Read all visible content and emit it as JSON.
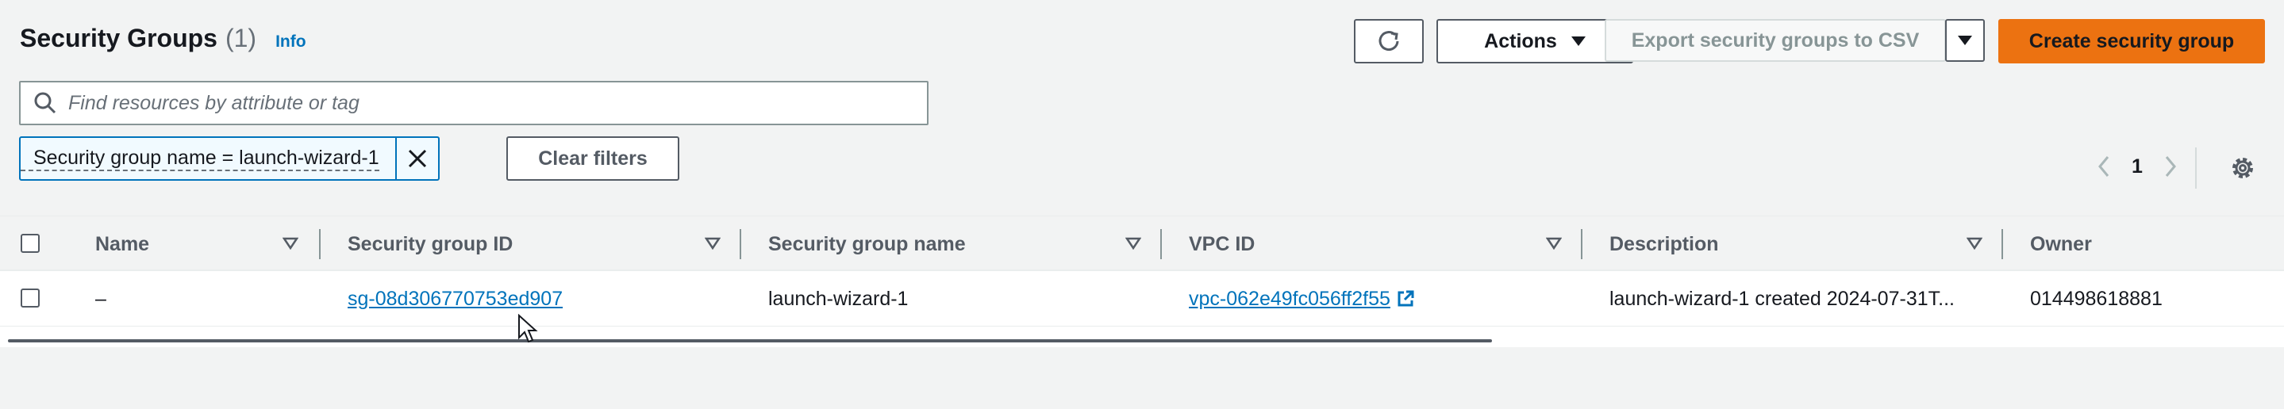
{
  "header": {
    "title": "Security Groups",
    "count": "(1)",
    "info": "Info"
  },
  "toolbar": {
    "refresh_icon": "refresh-icon",
    "actions_label": "Actions",
    "export_label": "Export security groups to CSV",
    "create_label": "Create security group"
  },
  "search": {
    "placeholder": "Find resources by attribute or tag",
    "value": ""
  },
  "filter": {
    "token_label": "Security group name = launch-wizard-1",
    "clear_label": "Clear filters"
  },
  "pagination": {
    "current_page": "1"
  },
  "table": {
    "columns": [
      "Name",
      "Security group ID",
      "Security group name",
      "VPC ID",
      "Description",
      "Owner"
    ],
    "rows": [
      {
        "name": "–",
        "security_group_id": "sg-08d306770753ed907",
        "security_group_name": "launch-wizard-1",
        "vpc_id": "vpc-062e49fc056ff2f55",
        "description": "launch-wizard-1 created 2024-07-31T...",
        "owner": "014498618881"
      }
    ]
  },
  "colors": {
    "accent": "#0073bb",
    "primary_button": "#ec7211",
    "background": "#f2f3f3"
  }
}
